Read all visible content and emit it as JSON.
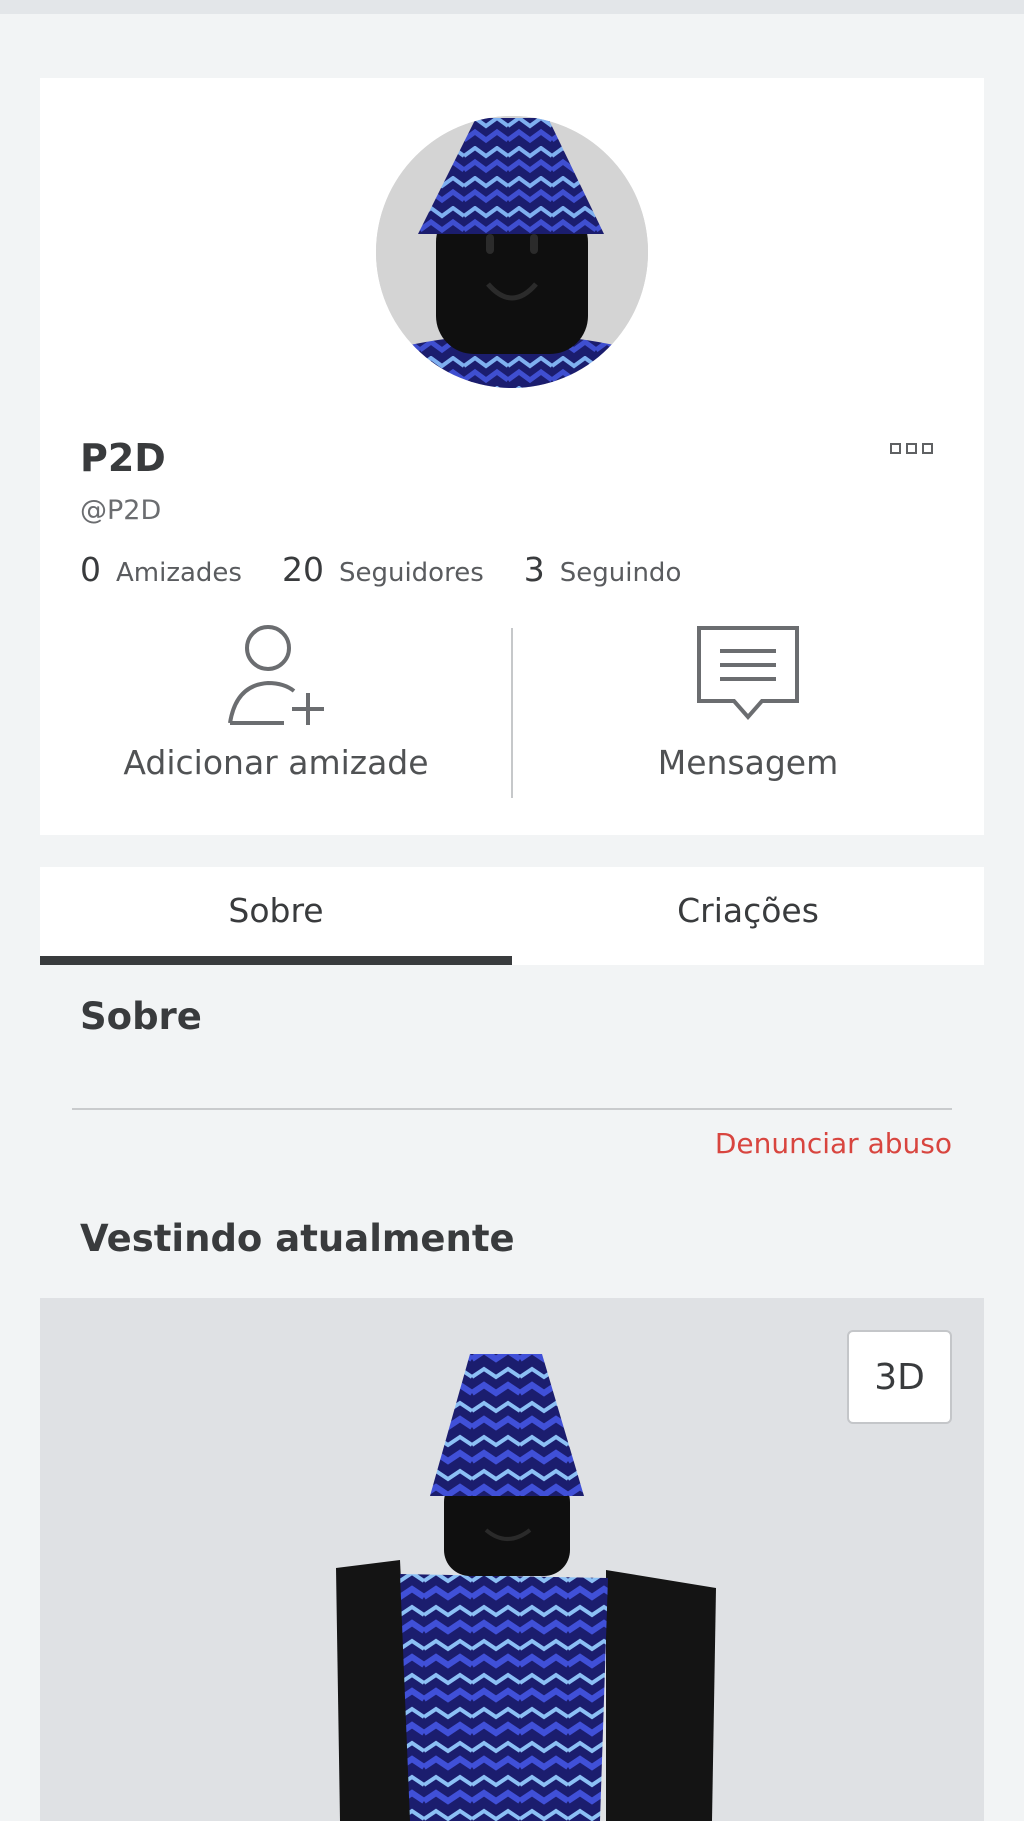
{
  "profile": {
    "display_name": "P2D",
    "username": "@P2D",
    "stats": [
      {
        "count": "0",
        "label": "Amizades"
      },
      {
        "count": "20",
        "label": "Seguidores"
      },
      {
        "count": "3",
        "label": "Seguindo"
      }
    ],
    "more_icon": "more-options-icon"
  },
  "actions": {
    "add_friend": {
      "label": "Adicionar amizade",
      "icon": "add-friend-icon"
    },
    "message": {
      "label": "Mensagem",
      "icon": "message-icon"
    }
  },
  "tabs": [
    {
      "label": "Sobre",
      "active": true
    },
    {
      "label": "Criações",
      "active": false
    }
  ],
  "about": {
    "title": "Sobre",
    "report_label": "Denunciar abuso"
  },
  "wearing": {
    "title": "Vestindo atualmente",
    "view_3d_label": "3D"
  },
  "colors": {
    "background": "#f2f4f5",
    "card": "#ffffff",
    "text_primary": "#393b3d",
    "report": "#d8453f",
    "outfit_dark_blue": "#1b1d6e",
    "outfit_light_blue": "#7fb0f0"
  }
}
